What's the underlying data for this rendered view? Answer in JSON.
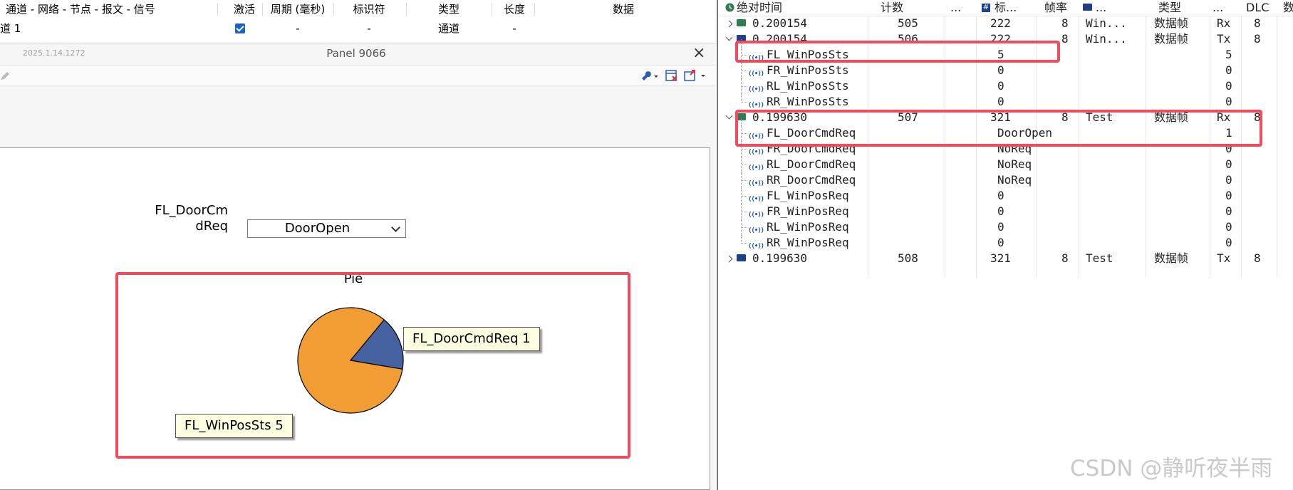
{
  "left_grid": {
    "headers": [
      "通道 - 网络 - 节点 - 报文 - 信号",
      "激活",
      "周期 (毫秒)",
      "标识符",
      "类型",
      "长度",
      "数据"
    ],
    "row": {
      "name": "道 1",
      "period": "-",
      "id": "-",
      "type": "通道",
      "length": "-"
    }
  },
  "panel": {
    "version": "2025.1.14.1272",
    "title": "Panel 9066",
    "close": "×",
    "combo_label_line1": "FL_DoorCm",
    "combo_label_line2": "dReq",
    "combo_value": "DoorOpen",
    "chart_data": {
      "type": "pie",
      "title": "Pie",
      "slices": [
        {
          "label": "FL_DoorCmdReq 1",
          "value": 1,
          "color": "#4561a0"
        },
        {
          "label": "FL_WinPosSts 5",
          "value": 5,
          "color": "#f29c34"
        }
      ]
    }
  },
  "trace": {
    "headers": {
      "time": "绝对时间",
      "count": "计数",
      "dots1": "...",
      "id": "标...",
      "rate": "帧率",
      "name": "...",
      "type": "类型",
      "dots2": "...",
      "dlc": "DLC",
      "data": "数"
    },
    "rows": [
      {
        "kind": "msg",
        "expand": "collapsed",
        "icon": "green",
        "time": "0.200154",
        "count": "505",
        "id": "222",
        "rate": "8",
        "name": "Win...",
        "type": "数据帧",
        "dir": "Rx",
        "dlc": "8"
      },
      {
        "kind": "msg",
        "expand": "expanded",
        "icon": "blue",
        "time": "0.200154",
        "count": "506",
        "id": "222",
        "rate": "8",
        "name": "Win...",
        "type": "数据帧",
        "dir": "Tx",
        "dlc": "8"
      },
      {
        "kind": "sig",
        "name": "FL_WinPosSts",
        "value": "5",
        "raw": "5"
      },
      {
        "kind": "sig",
        "name": "FR_WinPosSts",
        "value": "0",
        "raw": "0"
      },
      {
        "kind": "sig",
        "name": "RL_WinPosSts",
        "value": "0",
        "raw": "0"
      },
      {
        "kind": "sig",
        "name": "RR_WinPosSts",
        "value": "0",
        "raw": "0"
      },
      {
        "kind": "msg",
        "expand": "expanded",
        "icon": "green",
        "time": "0.199630",
        "count": "507",
        "id": "321",
        "rate": "8",
        "name": "Test",
        "type": "数据帧",
        "dir": "Rx",
        "dlc": "8"
      },
      {
        "kind": "sig",
        "name": "FL_DoorCmdReq",
        "value": "DoorOpen",
        "raw": "1"
      },
      {
        "kind": "sig",
        "name": "FR_DoorCmdReq",
        "value": "NoReq",
        "raw": "0"
      },
      {
        "kind": "sig",
        "name": "RL_DoorCmdReq",
        "value": "NoReq",
        "raw": "0"
      },
      {
        "kind": "sig",
        "name": "RR_DoorCmdReq",
        "value": "NoReq",
        "raw": "0"
      },
      {
        "kind": "sig",
        "name": "FL_WinPosReq",
        "value": "0",
        "raw": "0"
      },
      {
        "kind": "sig",
        "name": "FR_WinPosReq",
        "value": "0",
        "raw": "0"
      },
      {
        "kind": "sig",
        "name": "RL_WinPosReq",
        "value": "0",
        "raw": "0"
      },
      {
        "kind": "sig",
        "name": "RR_WinPosReq",
        "value": "0",
        "raw": "0"
      },
      {
        "kind": "msg",
        "expand": "collapsed",
        "icon": "blue",
        "time": "0.199630",
        "count": "508",
        "id": "321",
        "rate": "8",
        "name": "Test",
        "type": "数据帧",
        "dir": "Tx",
        "dlc": "8"
      }
    ]
  },
  "watermark": "CSDN @静听夜半雨",
  "colors": {
    "highlight": "#f04b5e",
    "checkbox": "#1a64c4"
  },
  "icons": {
    "wrench": "wrench-icon",
    "pencil": "pencil-icon",
    "clock": "clock-icon",
    "signal": "signal-icon",
    "envelope": "envelope-icon"
  }
}
